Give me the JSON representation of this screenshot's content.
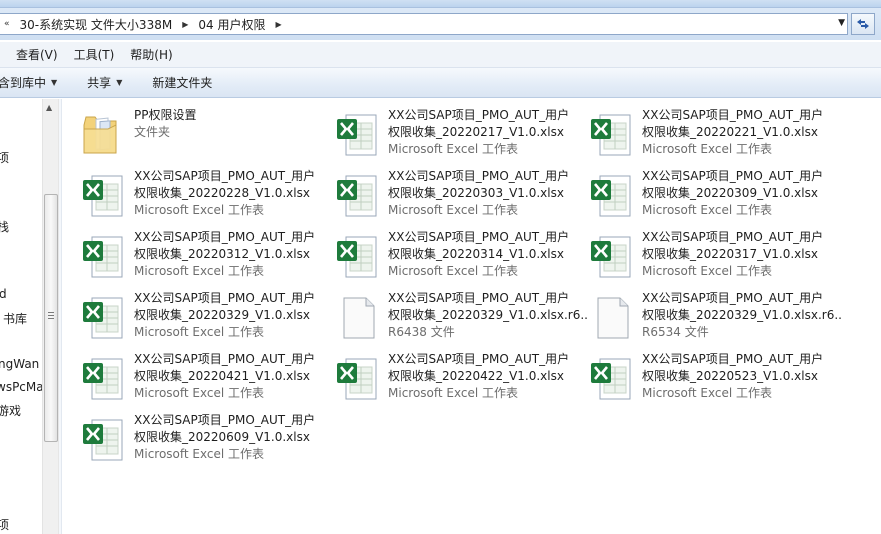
{
  "breadcrumb": {
    "segments": [
      "30-系统实现 文件大小338M",
      "04 用户权限"
    ]
  },
  "menu": {
    "items": [
      "查看(V)",
      "工具(T)",
      "帮助(H)"
    ]
  },
  "commands": {
    "include_library": "含到库中",
    "share": "共享",
    "new_folder": "新建文件夹"
  },
  "nav_pane": {
    "labels": [
      "项",
      "栈",
      "d",
      "书库",
      "ngWan",
      "wsPcMa",
      "游戏",
      "项"
    ]
  },
  "files": [
    {
      "line1": "PP权限设置",
      "line2": "",
      "type": "文件夹",
      "icon": "folder-icon"
    },
    {
      "line1": "XX公司SAP项目_PMO_AUT_用户",
      "line2": "权限收集_20220217_V1.0.xlsx",
      "type": "Microsoft Excel 工作表",
      "icon": "excel-icon"
    },
    {
      "line1": "XX公司SAP项目_PMO_AUT_用户",
      "line2": "权限收集_20220221_V1.0.xlsx",
      "type": "Microsoft Excel 工作表",
      "icon": "excel-icon"
    },
    {
      "line1": "XX公司SAP项目_PMO_AUT_用户",
      "line2": "权限收集_20220228_V1.0.xlsx",
      "type": "Microsoft Excel 工作表",
      "icon": "excel-icon"
    },
    {
      "line1": "XX公司SAP项目_PMO_AUT_用户",
      "line2": "权限收集_20220303_V1.0.xlsx",
      "type": "Microsoft Excel 工作表",
      "icon": "excel-icon"
    },
    {
      "line1": "XX公司SAP项目_PMO_AUT_用户",
      "line2": "权限收集_20220309_V1.0.xlsx",
      "type": "Microsoft Excel 工作表",
      "icon": "excel-icon"
    },
    {
      "line1": "XX公司SAP项目_PMO_AUT_用户",
      "line2": "权限收集_20220312_V1.0.xlsx",
      "type": "Microsoft Excel 工作表",
      "icon": "excel-icon"
    },
    {
      "line1": "XX公司SAP项目_PMO_AUT_用户",
      "line2": "权限收集_20220314_V1.0.xlsx",
      "type": "Microsoft Excel 工作表",
      "icon": "excel-icon"
    },
    {
      "line1": "XX公司SAP项目_PMO_AUT_用户",
      "line2": "权限收集_20220317_V1.0.xlsx",
      "type": "Microsoft Excel 工作表",
      "icon": "excel-icon"
    },
    {
      "line1": "XX公司SAP项目_PMO_AUT_用户",
      "line2": "权限收集_20220329_V1.0.xlsx",
      "type": "Microsoft Excel 工作表",
      "icon": "excel-icon"
    },
    {
      "line1": "XX公司SAP项目_PMO_AUT_用户",
      "line2": "权限收集_20220329_V1.0.xlsx.r6...",
      "type": "R6438 文件",
      "icon": "generic-file-icon"
    },
    {
      "line1": "XX公司SAP项目_PMO_AUT_用户",
      "line2": "权限收集_20220329_V1.0.xlsx.r6...",
      "type": "R6534 文件",
      "icon": "generic-file-icon"
    },
    {
      "line1": "XX公司SAP项目_PMO_AUT_用户",
      "line2": "权限收集_20220421_V1.0.xlsx",
      "type": "Microsoft Excel 工作表",
      "icon": "excel-icon"
    },
    {
      "line1": "XX公司SAP项目_PMO_AUT_用户",
      "line2": "权限收集_20220422_V1.0.xlsx",
      "type": "Microsoft Excel 工作表",
      "icon": "excel-icon"
    },
    {
      "line1": "XX公司SAP项目_PMO_AUT_用户",
      "line2": "权限收集_20220523_V1.0.xlsx",
      "type": "Microsoft Excel 工作表",
      "icon": "excel-icon"
    },
    {
      "line1": "XX公司SAP项目_PMO_AUT_用户",
      "line2": "权限收集_20220609_V1.0.xlsx",
      "type": "Microsoft Excel 工作表",
      "icon": "excel-icon"
    }
  ],
  "colors": {
    "excel_green": "#1e7b3c",
    "folder_yellow": "#f3d27a",
    "type_text": "#6d6d6d"
  }
}
